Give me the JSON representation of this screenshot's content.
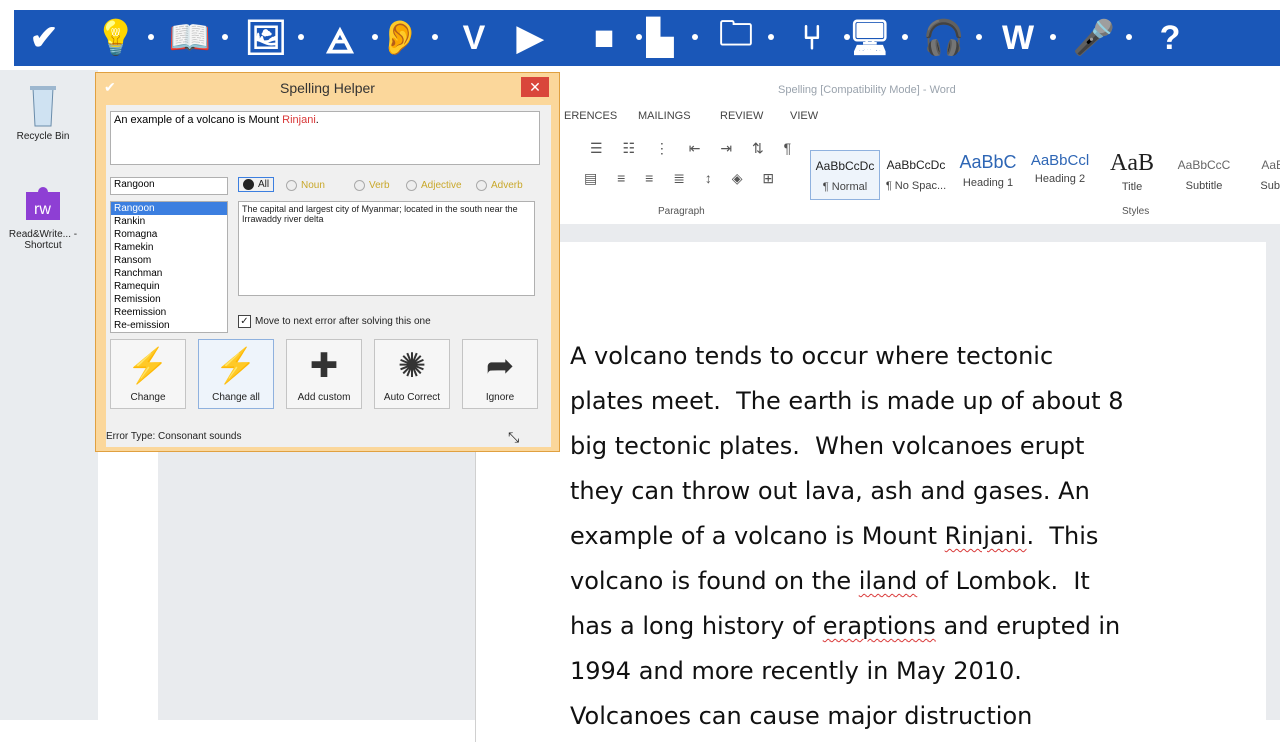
{
  "toolbar": {
    "buttons": [
      {
        "icon": "check-icon",
        "glyph": "✔"
      },
      {
        "icon": "predict-icon",
        "glyph": "💡"
      },
      {
        "icon": "dictionary-icon",
        "glyph": "📖"
      },
      {
        "icon": "picture-dictionary-icon",
        "glyph": "🖼"
      },
      {
        "icon": "homophones-icon",
        "glyph": "🜁"
      },
      {
        "icon": "speech-icon",
        "glyph": "👂"
      },
      {
        "icon": "vocabulary-icon",
        "glyph": "V"
      },
      {
        "icon": "play-icon",
        "glyph": "▶"
      },
      {
        "icon": "stop-icon",
        "glyph": "■"
      },
      {
        "icon": "screenshot-reader-icon",
        "glyph": "▙"
      },
      {
        "icon": "fact-folder-icon",
        "glyph": "🗀"
      },
      {
        "icon": "mind-map-icon",
        "glyph": "⑂"
      },
      {
        "icon": "screen-mask-icon",
        "glyph": "🖥"
      },
      {
        "icon": "audio-maker-icon",
        "glyph": "🎧"
      },
      {
        "icon": "web-search-icon",
        "glyph": "W"
      },
      {
        "icon": "voice-note-icon",
        "glyph": "🎤"
      },
      {
        "icon": "help-icon",
        "glyph": "?"
      }
    ]
  },
  "desktop": {
    "items": [
      {
        "label": "Recycle Bin",
        "icon": "recycle-bin-icon"
      },
      {
        "label": "Read&Write... - Shortcut",
        "icon": "readwrite-shortcut-icon"
      }
    ]
  },
  "word": {
    "title": "Spelling [Compatibility Mode] - Word",
    "tabs": [
      "ERENCES",
      "MAILINGS",
      "REVIEW",
      "VIEW"
    ],
    "ribbon": {
      "group_paragraph": "Paragraph",
      "group_styles": "Styles",
      "styles": [
        {
          "sample": "AaBbCcDc",
          "label": "¶ Normal"
        },
        {
          "sample": "AaBbCcDc",
          "label": "¶ No Spac..."
        },
        {
          "sample": "AaBbC",
          "label": "Heading 1"
        },
        {
          "sample": "AaBbCcl",
          "label": "Heading 2"
        },
        {
          "sample": "AaB",
          "label": "Title"
        },
        {
          "sample": "AaBbCcC",
          "label": "Subtitle"
        },
        {
          "sample": "AaBb",
          "label": "Subtle"
        }
      ]
    },
    "document": {
      "lines": [
        "A volcano tends to occur where tectonic",
        "plates meet.  The earth is made up of about 8",
        "big tectonic plates.  When volcanoes erupt",
        "they can throw out lava, ash and gases. An",
        "example of a volcano is Mount |Rinjani|.  This",
        "volcano is found on the |iland| of Lombok.  It",
        "has a long history of |eraptions| and erupted in",
        "1994 and more recently in May 2010.",
        "Volcanoes can cause major distruction"
      ]
    }
  },
  "spelling_helper": {
    "title": "Spelling Helper",
    "close_label": "✕",
    "sentence_prefix": "An example of a volcano is Mount ",
    "sentence_error": "Rinjani",
    "sentence_suffix": ".",
    "word_input": "Rangoon",
    "suggestions": [
      "Rangoon",
      "Rankin",
      "Romagna",
      "Ramekin",
      "Ransom",
      "Ranchman",
      "Ramequin",
      "Remission",
      "Reemission",
      "Re-emission"
    ],
    "selected_index": 0,
    "pos_filters": [
      "All",
      "Noun",
      "Verb",
      "Adjective",
      "Adverb"
    ],
    "definition": "The capital and largest city of Myanmar; located in the south near the Irrawaddy river delta",
    "move_next_label": "Move to next error after solving this one",
    "actions": [
      {
        "label": "Change",
        "icon": "change-icon"
      },
      {
        "label": "Change all",
        "icon": "change-all-icon"
      },
      {
        "label": "Add custom",
        "icon": "add-custom-icon"
      },
      {
        "label": "Auto Correct",
        "icon": "auto-correct-icon"
      },
      {
        "label": "Ignore",
        "icon": "ignore-icon"
      }
    ],
    "status": "Error Type: Consonant sounds",
    "accent_color": "#fbd79b",
    "selection_color": "#3c7fe0"
  },
  "colors": {
    "toolbar_bg": "#1a57b8",
    "error_underline": "#d93838"
  }
}
